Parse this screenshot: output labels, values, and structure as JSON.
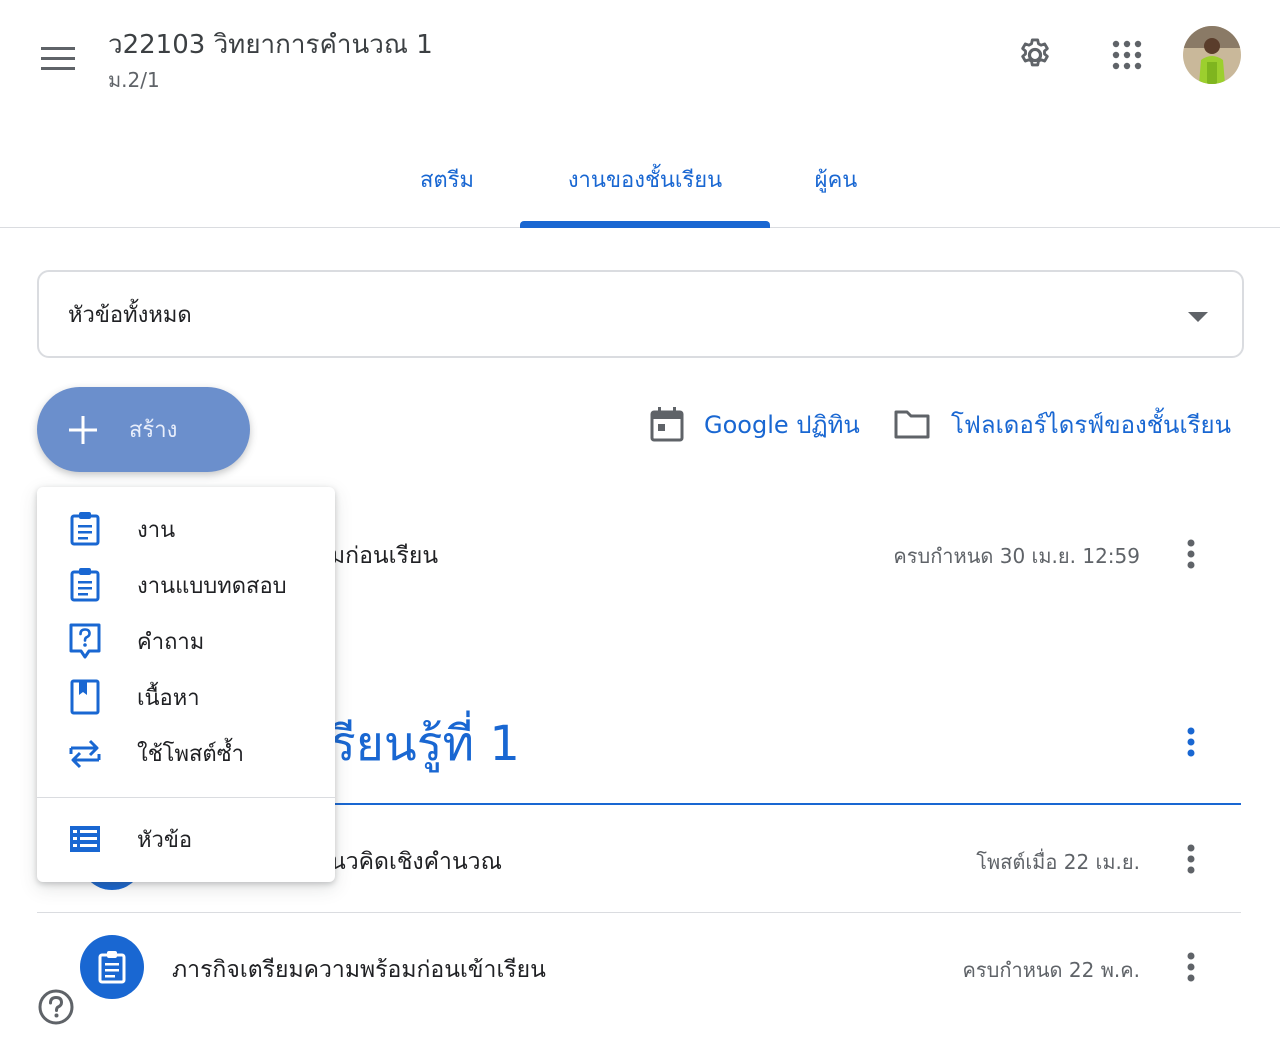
{
  "header": {
    "class_title": "ว22103 วิทยาการคำนวณ 1",
    "class_section": "ม.2/1",
    "icons": [
      "menu-icon",
      "gear-icon",
      "apps-grid-icon",
      "avatar"
    ]
  },
  "tabs": [
    {
      "label": "สตรีม",
      "active": false
    },
    {
      "label": "งานของชั้นเรียน",
      "active": true
    },
    {
      "label": "ผู้คน",
      "active": false
    }
  ],
  "topic_filter": {
    "selected": "หัวข้อทั้งหมด"
  },
  "toolbar": {
    "create_label": "สร้าง",
    "calendar_label": "Google ปฏิทิน",
    "drive_label": "โฟลเดอร์ไดรฟ์ของชั้นเรียน"
  },
  "create_menu": {
    "items": [
      {
        "label": "งาน",
        "icon": "assignment-icon"
      },
      {
        "label": "งานแบบทดสอบ",
        "icon": "quiz-assignment-icon"
      },
      {
        "label": "คำถาม",
        "icon": "question-icon"
      },
      {
        "label": "เนื้อหา",
        "icon": "material-icon"
      },
      {
        "label": "ใช้โพสต์ซ้ำ",
        "icon": "reuse-post-icon"
      }
    ],
    "topic_item": {
      "label": "หัวข้อ",
      "icon": "topic-list-icon"
    }
  },
  "stream": {
    "top_item": {
      "title_visible": "มก่อนเรียน",
      "meta": "ครบกำหนด 30 เม.ย. 12:59"
    },
    "topic": {
      "heading_visible": "รียนรู้ที่ 1",
      "items": [
        {
          "title_visible": "นวคิดเชิงคำนวณ",
          "meta": "โพสต์เมื่อ 22 เม.ย."
        },
        {
          "title": "ภารกิจเตรียมความพร้อมก่อนเข้าเรียน",
          "meta": "ครบกำหนด 22 พ.ค.",
          "icon": "assignment-icon"
        }
      ]
    }
  },
  "colors": {
    "accent": "#1967d2",
    "create_button": "#6b8fcc",
    "text_primary": "#202124",
    "text_secondary": "#5f6368",
    "divider": "#dadce0"
  }
}
